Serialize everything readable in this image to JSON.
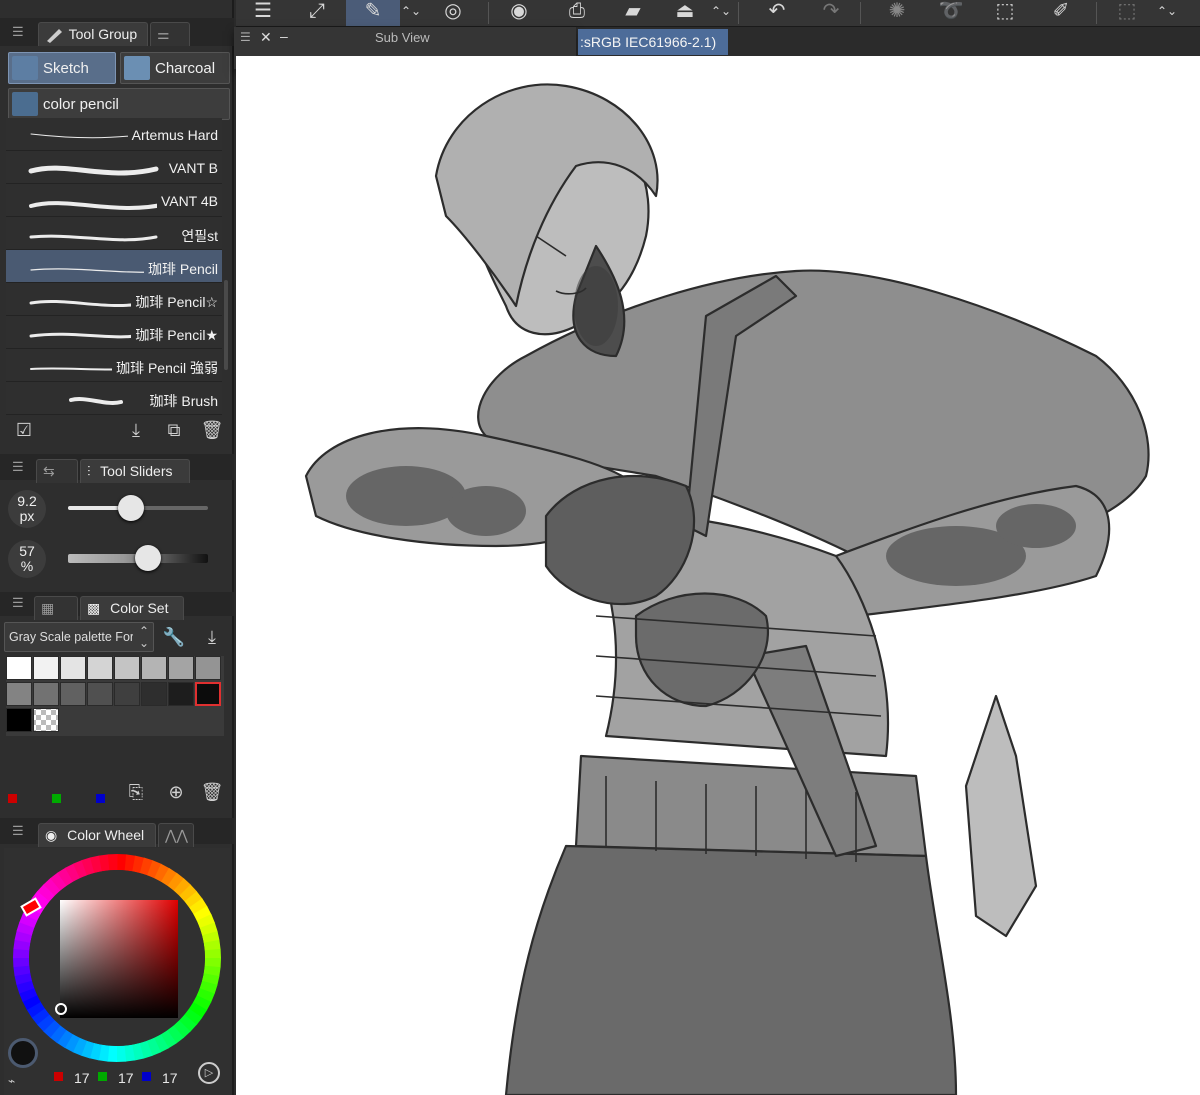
{
  "tool_group": {
    "tab_label": "Tool Group",
    "subtools": [
      {
        "label": "Sketch",
        "selected": true
      },
      {
        "label": "Charcoal",
        "selected": false
      },
      {
        "label": "color pencil",
        "selected": false
      }
    ],
    "brushes": [
      {
        "label": "Artemus Hard",
        "selected": false
      },
      {
        "label": "VANT B",
        "selected": false
      },
      {
        "label": "VANT 4B",
        "selected": false
      },
      {
        "label": "연필st",
        "selected": false
      },
      {
        "label": "珈琲 Pencil",
        "selected": true
      },
      {
        "label": "珈琲 Pencil☆",
        "selected": false
      },
      {
        "label": "珈琲 Pencil★",
        "selected": false
      },
      {
        "label": "珈琲 Pencil 強弱",
        "selected": false
      },
      {
        "label": "珈琲 Brush",
        "selected": false
      }
    ]
  },
  "tool_sliders": {
    "tab_label": "Tool Sliders",
    "size": {
      "value": "9.2",
      "unit": "px",
      "fraction": 0.45
    },
    "opacity": {
      "value": "57",
      "unit": "%",
      "fraction": 0.57
    }
  },
  "color_set": {
    "tab_label": "Color Set",
    "palette_name": "Gray Scale palette For Gr",
    "swatches": [
      "#ffffff",
      "#f2f2f2",
      "#e4e4e4",
      "#d4d4d4",
      "#c4c4c4",
      "#b4b4b4",
      "#a4a4a4",
      "#949494",
      "#838383",
      "#727272",
      "#616161",
      "#505050",
      "#3f3f3f",
      "#2e2e2e",
      "#1d1d1d",
      "#0c0c0c",
      "#000000",
      "transparent"
    ],
    "channel_colors": [
      "#cc0000",
      "#00aa00",
      "#0000cc"
    ]
  },
  "color_wheel": {
    "tab_label": "Color Wheel",
    "rgb": [
      "17",
      "17",
      "17"
    ],
    "hue_color": "#ff0000"
  },
  "toolbar": {
    "active_color": "#4b5c78"
  },
  "subview": {
    "title": "Sub View",
    "close_glyph": "✕",
    "min_glyph": "–"
  },
  "canvas": {
    "profile_tag": ":sRGB IEC61966-2.1)"
  }
}
